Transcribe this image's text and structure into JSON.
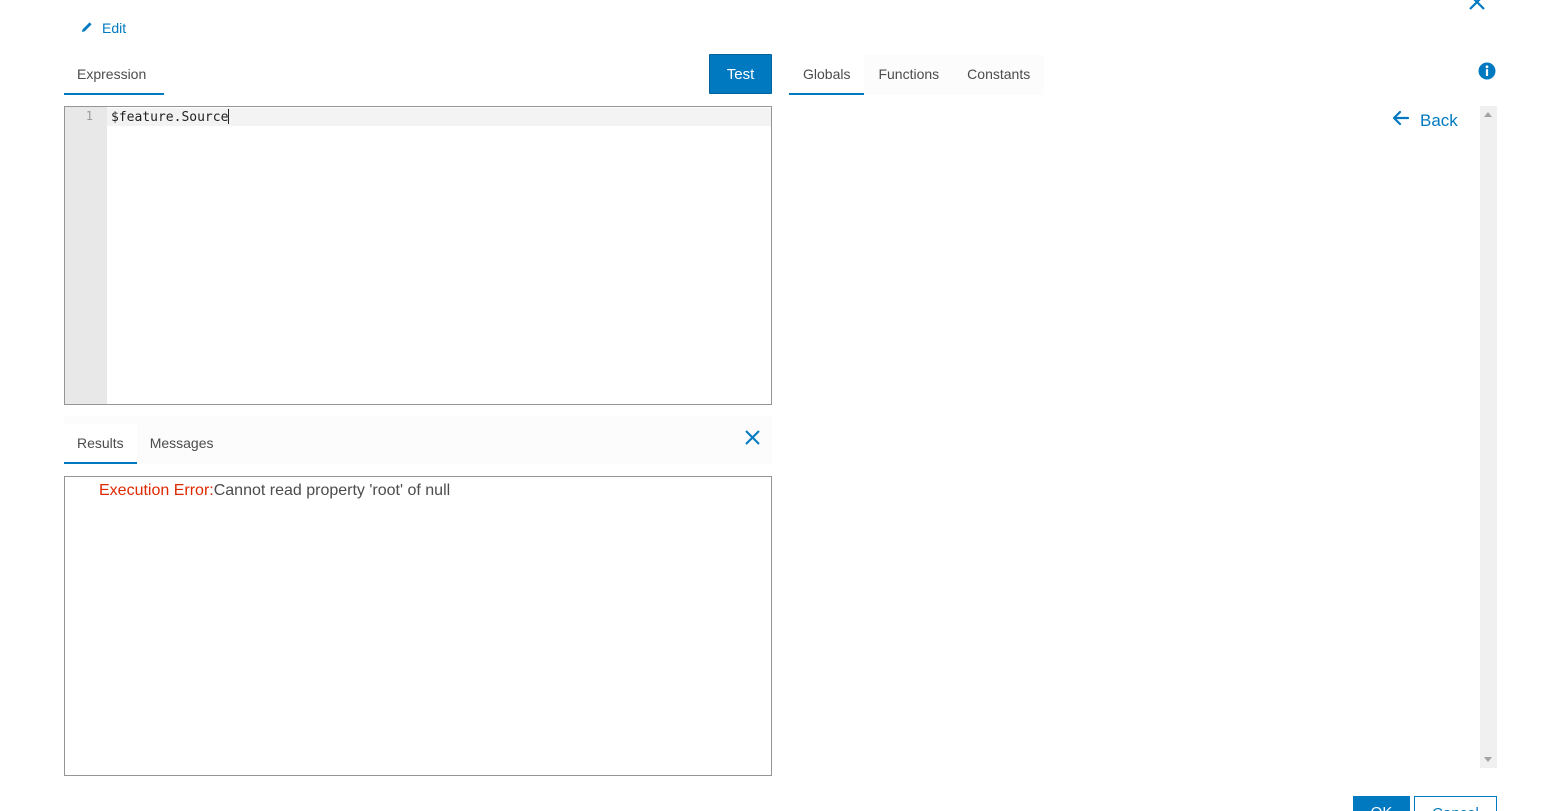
{
  "header": {
    "edit_label": "Edit"
  },
  "expression_panel": {
    "tabs": [
      {
        "label": "Expression",
        "active": true
      }
    ],
    "test_label": "Test",
    "editor": {
      "line_numbers": [
        "1"
      ],
      "code": "$feature.Source"
    }
  },
  "results_panel": {
    "tabs": [
      {
        "label": "Results",
        "active": true
      },
      {
        "label": "Messages",
        "active": false
      }
    ],
    "error_label": "Execution Error:",
    "error_message": "Cannot read property 'root' of null"
  },
  "reference_panel": {
    "tabs": [
      {
        "label": "Globals",
        "active": true
      },
      {
        "label": "Functions",
        "active": false
      },
      {
        "label": "Constants",
        "active": false
      }
    ],
    "back_label": "Back"
  },
  "footer": {
    "ok_label": "OK",
    "cancel_label": "Cancel"
  },
  "colors": {
    "accent": "#0079c1",
    "error": "#de2900"
  },
  "icons": [
    "close-icon",
    "pencil-icon",
    "info-icon",
    "arrow-left-icon",
    "close-icon"
  ]
}
